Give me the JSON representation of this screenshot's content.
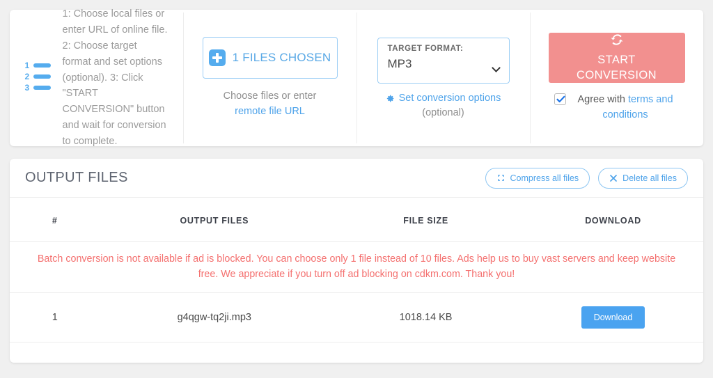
{
  "instructions": {
    "icon": "numbered-list-icon",
    "text": "1: Choose local files or enter URL of online file. 2: Choose target format and set options (optional). 3: Click \"START CONVERSION\" button and wait for conversion to complete."
  },
  "choose_files": {
    "icon": "plus-square-icon",
    "button_label": "1 FILES CHOSEN",
    "hint_prefix": "Choose files or enter ",
    "hint_link": "remote file URL"
  },
  "target_format": {
    "label": "TARGET FORMAT:",
    "value": "MP3",
    "options": [
      "MP3"
    ],
    "chevron_icon": "chevron-down-icon",
    "options_icon": "gear-icon",
    "options_link": "Set conversion options",
    "optional_note": "(optional)"
  },
  "start": {
    "icon": "sync-icon",
    "button_label": "START CONVERSION",
    "button_color": "#f2908f",
    "checkbox_checked": true,
    "agree_prefix": "Agree with ",
    "agree_link": "terms and conditions"
  },
  "output": {
    "title": "OUTPUT FILES",
    "compress_icon": "compress-icon",
    "compress_label": "Compress all files",
    "delete_icon": "close-icon",
    "delete_label": "Delete all files",
    "columns": {
      "num": "#",
      "name": "OUTPUT FILES",
      "size": "FILE SIZE",
      "download": "DOWNLOAD"
    },
    "warning": "Batch conversion is not available if ad is blocked. You can choose only 1 file instead of 10 files. Ads help us to buy vast servers and keep website free. We appreciate if you turn off ad blocking on cdkm.com. Thank you!",
    "warning_color": "#f4706f",
    "rows": [
      {
        "num": "1",
        "name": "g4qgw-tq2ji.mp3",
        "size": "1018.14 KB",
        "download_label": "Download"
      }
    ]
  },
  "colors": {
    "accent_blue": "#4ea3ea",
    "salmon": "#f2908f",
    "page_bg": "#f0f0f0"
  }
}
